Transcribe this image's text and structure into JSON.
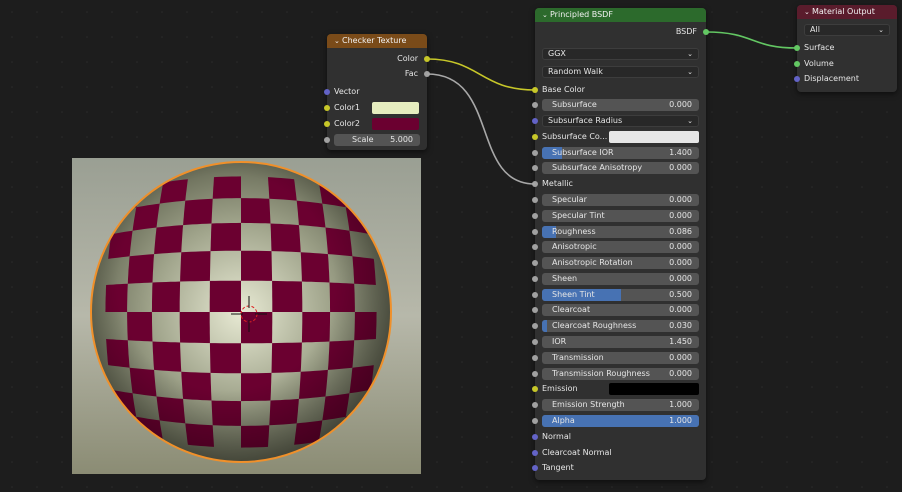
{
  "checker": {
    "title": "Checker Texture",
    "outputs": {
      "color": "Color",
      "fac": "Fac"
    },
    "inputs": {
      "vector": "Vector",
      "color1": "Color1",
      "color2": "Color2"
    },
    "color1_value": "#e6edbf",
    "color2_value": "#6b0030",
    "scale_label": "Scale",
    "scale_value": "5.000"
  },
  "bsdf": {
    "title": "Principled BSDF",
    "output": "BSDF",
    "distribution": "GGX",
    "subsurface_method": "Random Walk",
    "base_color": "Base Color",
    "subsurface": {
      "label": "Subsurface",
      "value": "0.000",
      "fill": 0
    },
    "subsurface_radius": "Subsurface Radius",
    "subsurface_color": {
      "label": "Subsurface Co...",
      "value": "#e6e6e6"
    },
    "subsurface_ior": {
      "label": "Subsurface IOR",
      "value": "1.400",
      "fill": 0.13
    },
    "subsurface_anisotropy": {
      "label": "Subsurface Anisotropy",
      "value": "0.000",
      "fill": 0
    },
    "metallic": "Metallic",
    "specular": {
      "label": "Specular",
      "value": "0.000",
      "fill": 0
    },
    "specular_tint": {
      "label": "Specular Tint",
      "value": "0.000",
      "fill": 0
    },
    "roughness": {
      "label": "Roughness",
      "value": "0.086",
      "fill": 0.086
    },
    "anisotropic": {
      "label": "Anisotropic",
      "value": "0.000",
      "fill": 0
    },
    "anisotropic_rotation": {
      "label": "Anisotropic Rotation",
      "value": "0.000",
      "fill": 0
    },
    "sheen": {
      "label": "Sheen",
      "value": "0.000",
      "fill": 0
    },
    "sheen_tint": {
      "label": "Sheen Tint",
      "value": "0.500",
      "fill": 0.5
    },
    "clearcoat": {
      "label": "Clearcoat",
      "value": "0.000",
      "fill": 0
    },
    "clearcoat_roughness": {
      "label": "Clearcoat Roughness",
      "value": "0.030",
      "fill": 0.03
    },
    "ior": {
      "label": "IOR",
      "value": "1.450",
      "fill": 0
    },
    "transmission": {
      "label": "Transmission",
      "value": "0.000",
      "fill": 0
    },
    "transmission_roughness": {
      "label": "Transmission Roughness",
      "value": "0.000",
      "fill": 0
    },
    "emission": {
      "label": "Emission",
      "value": "#000000"
    },
    "emission_strength": {
      "label": "Emission Strength",
      "value": "1.000",
      "fill": 0
    },
    "alpha": {
      "label": "Alpha",
      "value": "1.000",
      "fill": 1
    },
    "normal": "Normal",
    "clearcoat_normal": "Clearcoat Normal",
    "tangent": "Tangent"
  },
  "material_output": {
    "title": "Material Output",
    "target": "All",
    "inputs": {
      "surface": "Surface",
      "volume": "Volume",
      "displacement": "Displacement"
    }
  },
  "colors": {
    "texture_header": "#7a4b19",
    "shader_header": "#2c6a2c",
    "output_header": "#5a1c2c",
    "color_socket": "#c7c729",
    "float_socket": "#a1a1a1",
    "vector_socket": "#6363c7",
    "shader_socket": "#63c763",
    "slider_fill": "#4772b3",
    "checker_dark": "#6b0030",
    "selection_outline": "#f0902a"
  }
}
